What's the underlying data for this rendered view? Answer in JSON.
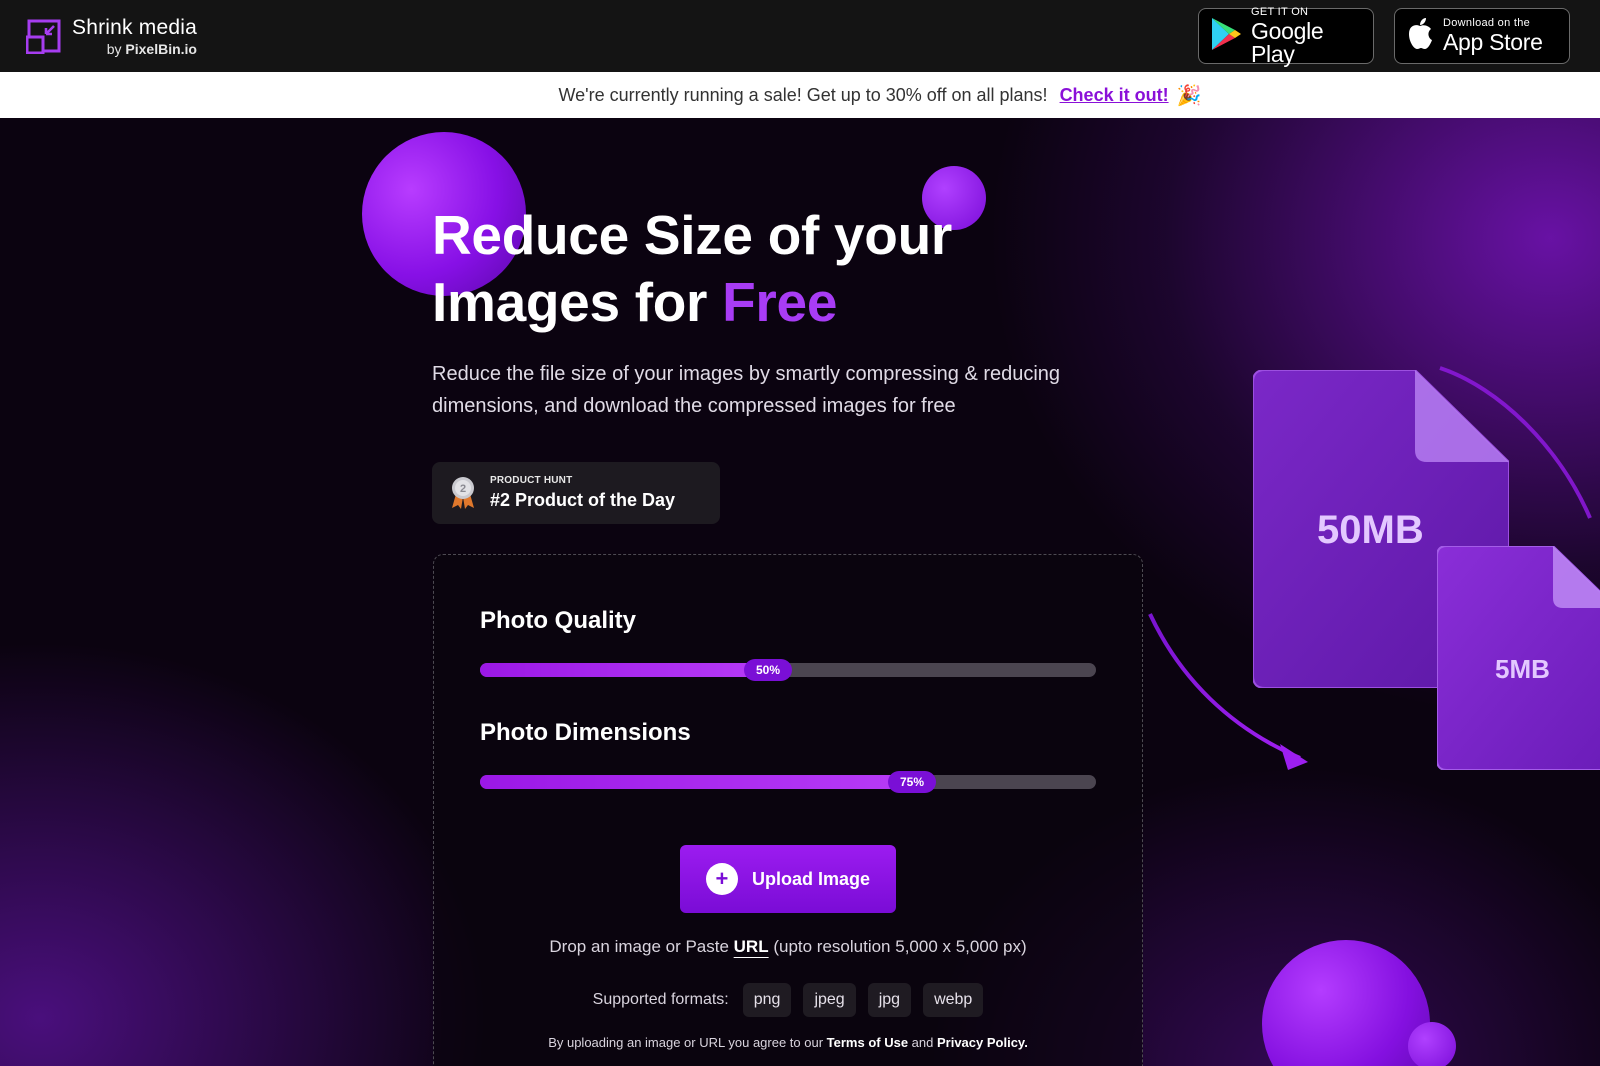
{
  "header": {
    "brand_name": "Shrink media",
    "brand_by_prefix": "by",
    "brand_by_name": "PixelBin.io",
    "google_play": {
      "small": "GET IT ON",
      "big": "Google Play"
    },
    "app_store": {
      "small": "Download on the",
      "big": "App Store"
    }
  },
  "salebar": {
    "message": "We're currently running a sale! Get up to 30% off on all plans!",
    "link": "Check it out!",
    "emoji": "🎉"
  },
  "hero": {
    "title_line1": "Reduce Size of your",
    "title_line2_prefix": "Images for ",
    "title_line2_accent": "Free",
    "subtitle": "Reduce the file size of your images by smartly compressing & reducing dimensions, and download the compressed images for free",
    "badge": {
      "rank": "2",
      "small": "PRODUCT HUNT",
      "big": "#2 Product of the Day"
    }
  },
  "card": {
    "quality": {
      "label": "Photo Quality",
      "value_text": "50%",
      "value": 0.5
    },
    "dimensions": {
      "label": "Photo Dimensions",
      "value_text": "75%",
      "value": 0.75
    },
    "upload_label": "Upload Image",
    "drop_prefix": "Drop an image or Paste ",
    "drop_link": "URL",
    "drop_suffix": " (upto resolution 5,000 x 5,000 px)",
    "formats_label": "Supported formats:",
    "formats": [
      "png",
      "jpeg",
      "jpg",
      "webp"
    ],
    "terms_prefix": "By uploading an image or URL you agree to our ",
    "terms_link": "Terms of Use",
    "terms_mid": " and ",
    "privacy_link": "Privacy Policy."
  },
  "illustration": {
    "big_file_label": "50MB",
    "small_file_label": "5MB"
  },
  "colors": {
    "accent": "#a83cf5",
    "button": "#8a12e4",
    "header_bg": "#141414"
  }
}
